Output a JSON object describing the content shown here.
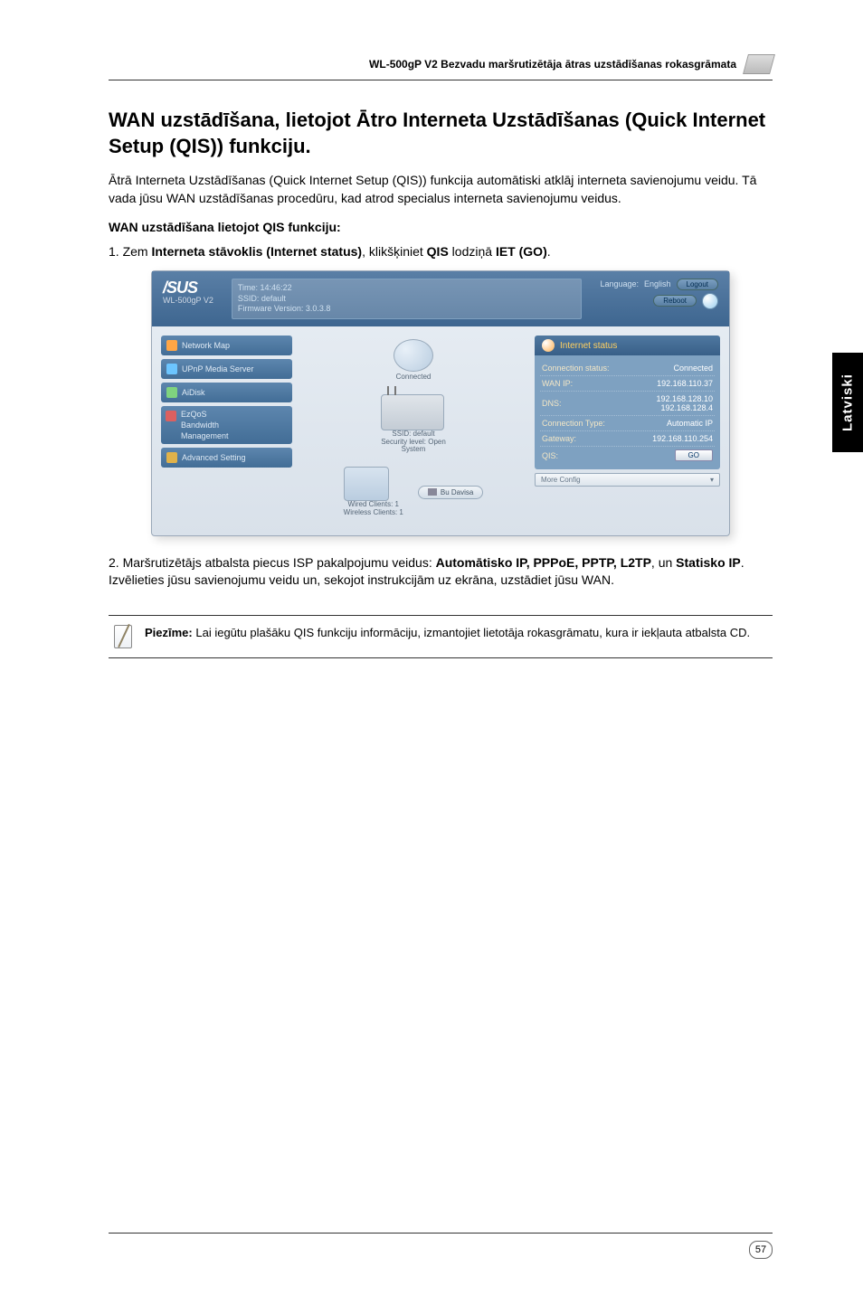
{
  "doc_header": "WL-500gP V2 Bezvadu maršrutizētāja ātras uzstādīšanas rokasgrāmata",
  "side_tab": "Latviski",
  "h1": "WAN uzstādīšana, lietojot Ātro Interneta Uzstādīšanas (Quick Internet Setup (QIS)) funkciju.",
  "intro": "Ātrā Interneta Uzstādīšanas (Quick Internet Setup (QIS)) funkcija automātiski atklāj interneta savienojumu veidu. Tā vada jūsu WAN uzstādīšanas procedūru, kad atrod specialus interneta savienojumu veidus.",
  "subhead": "WAN uzstādīšana lietojot QIS funkciju:",
  "step1_prefix": "1.  Zem ",
  "step1_b1": "Interneta stāvoklis (Internet status)",
  "step1_mid": ", klikšķiniet ",
  "step1_b2": "QIS",
  "step1_mid2": " lodziņā ",
  "step1_b3": "IET (GO)",
  "step1_end": ".",
  "router_ui": {
    "logo_top": "/SUS",
    "logo_sub": "WL-500gP V2",
    "top_mid_l1": "Time: 14:46:22",
    "top_mid_l2": "SSID: default",
    "top_mid_l3": "Firmware Version: 3.0.3.8",
    "lang_label": "Language:",
    "lang_value": "English",
    "btn_logout": "Logout",
    "btn_reboot": "Reboot",
    "sidebar": {
      "item0": "Network Map",
      "item1": "UPnP Media Server",
      "item2": "AiDisk",
      "item3a": "EzQoS",
      "item3b": "Bandwidth",
      "item3c": "Management",
      "item4": "Advanced Setting"
    },
    "diagram": {
      "node_globe": "Connected",
      "router_l1": "SSID: default",
      "router_l2": "Security level: Open",
      "router_l3": "System",
      "bu_button": "Bu Davisa",
      "clients_l1": "Wired Clients: 1",
      "clients_l2": "Wireless Clients: 1"
    },
    "status": {
      "header": "Internet status",
      "rows": [
        {
          "k": "Connection status:",
          "v": "Connected"
        },
        {
          "k": "WAN IP:",
          "v": "192.168.110.37"
        },
        {
          "k": "DNS:",
          "v": "192.168.128.10\n192.168.128.4"
        },
        {
          "k": "Connection Type:",
          "v": "Automatic IP"
        },
        {
          "k": "Gateway:",
          "v": "192.168.110.254"
        },
        {
          "k": "QIS:",
          "v": "GO"
        }
      ],
      "qis_label": "QIS:",
      "qis_btn": "GO",
      "more_config": "More Config"
    }
  },
  "step2_prefix": "2.  Maršrutizētājs atbalsta piecus ISP pakalpojumu veidus: ",
  "step2_b1": "Automātisko IP, PPPoE, PPTP, L2TP",
  "step2_mid": ", un ",
  "step2_b2": "Statisko IP",
  "step2_rest": ". Izvēlieties jūsu savienojumu veidu un, sekojot instrukcijām uz ekrāna, uzstādiet jūsu WAN.",
  "note_label": "Piezīme:",
  "note_text": " Lai iegūtu plašāku QIS funkciju informāciju, izmantojiet lietotāja rokasgrāmatu, kura ir iekļauta atbalsta CD.",
  "page_number": "57"
}
